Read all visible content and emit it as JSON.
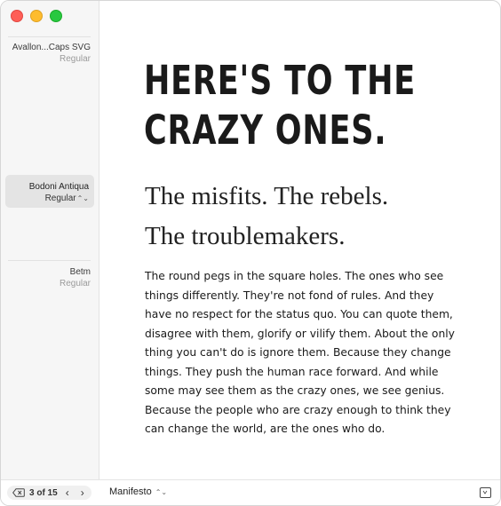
{
  "sidebar": {
    "fonts": [
      {
        "name": "Avallon...Caps SVG",
        "style": "Regular"
      },
      {
        "name": "Bodoni Antiqua",
        "style": "Regular"
      },
      {
        "name": "Betm",
        "style": "Regular"
      }
    ],
    "selected_index": 1
  },
  "content": {
    "headline": [
      "HERE'S TO THE",
      "CRAZY ONES."
    ],
    "subhead": [
      "The misfits. The rebels.",
      "The troublemakers."
    ],
    "body": [
      "The round pegs in the square holes. The ones who see",
      "things differently. They're not fond of rules. And they",
      "have no respect for the status quo. You can quote them,",
      "disagree with them, glorify or vilify them. About the only",
      "thing you can't do is ignore them. Because they change",
      "things. They push the human race forward. And while",
      "some may see them as the crazy ones, we see genius.",
      "Because the people who are crazy enough to think they",
      "can change the world, are the ones who do."
    ]
  },
  "bottombar": {
    "page_counter": "3 of 15",
    "sample_text_select": "Manifesto"
  },
  "icons": {
    "delete": "delete-left-icon",
    "prev": "chevron-left-icon",
    "next": "chevron-right-icon",
    "updown": "chevron-up-down-icon",
    "corner": "sidebar-toggle-icon"
  }
}
